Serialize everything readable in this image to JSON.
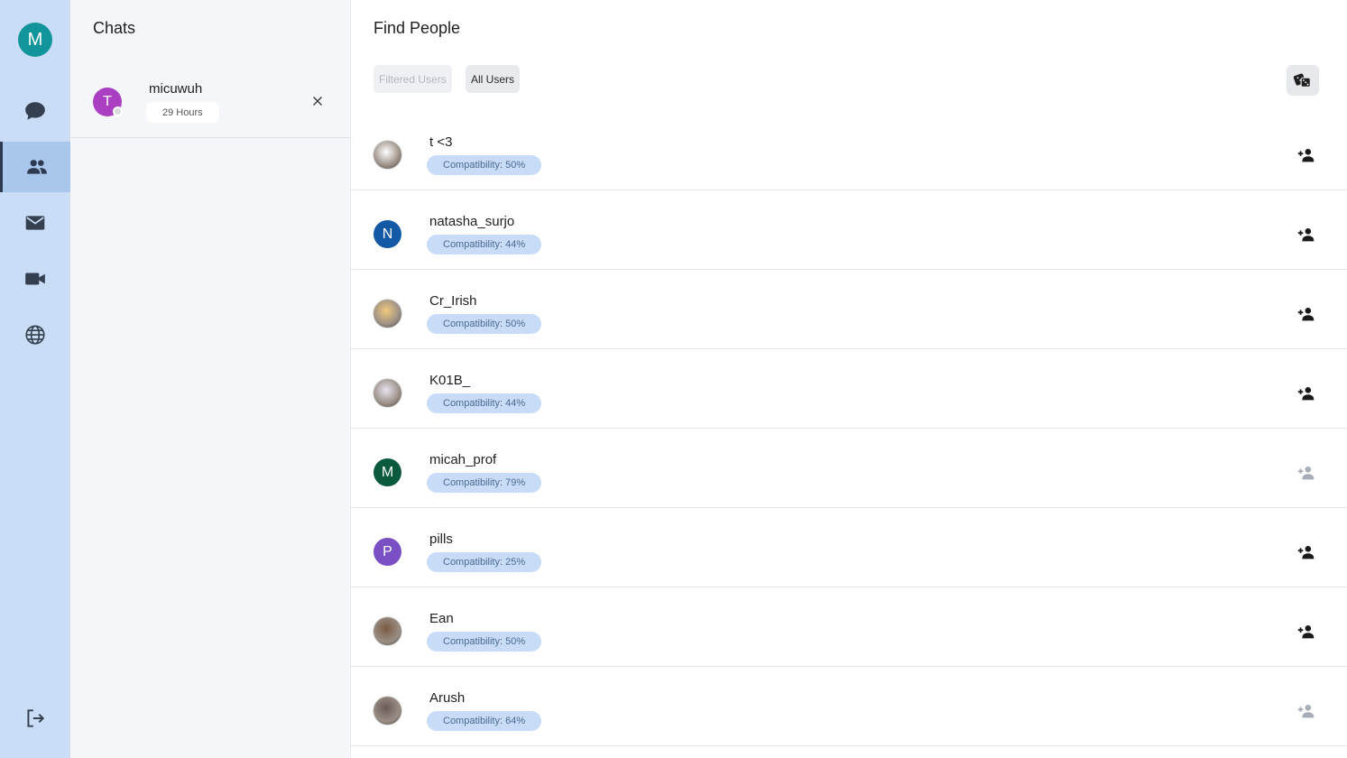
{
  "rail": {
    "user_initial": "M",
    "items": [
      {
        "icon": "chat-bubble-icon",
        "active": false
      },
      {
        "icon": "people-icon",
        "active": true
      },
      {
        "icon": "mail-icon",
        "active": false
      },
      {
        "icon": "video-camera-icon",
        "active": false
      },
      {
        "icon": "globe-icon",
        "active": false
      }
    ],
    "logout_icon": "logout-icon"
  },
  "chats": {
    "title": "Chats",
    "items": [
      {
        "initial": "T",
        "name": "micuwuh",
        "time": "29 Hours",
        "avatar_color": "#ab3fc2"
      }
    ]
  },
  "main": {
    "title": "Find People",
    "filters": {
      "filtered": "Filtered Users",
      "all": "All Users"
    },
    "random_icon": "dice-icon",
    "people": [
      {
        "name": "t <3",
        "compat": "Compatibility: 50%",
        "initial": "",
        "avatar_color": "#ffffff",
        "photo": true,
        "add_enabled": true
      },
      {
        "name": "natasha_surjo",
        "compat": "Compatibility: 44%",
        "initial": "N",
        "avatar_color": "#1459a5",
        "photo": false,
        "add_enabled": true
      },
      {
        "name": "Cr_Irish",
        "compat": "Compatibility: 50%",
        "initial": "",
        "avatar_color": "#f1c97c",
        "photo": true,
        "add_enabled": true
      },
      {
        "name": "K01B_",
        "compat": "Compatibility: 44%",
        "initial": "",
        "avatar_color": "#e7e3ef",
        "photo": true,
        "add_enabled": true
      },
      {
        "name": "micah_prof",
        "compat": "Compatibility: 79%",
        "initial": "M",
        "avatar_color": "#0b5a3e",
        "photo": false,
        "add_enabled": false
      },
      {
        "name": "pills",
        "compat": "Compatibility: 25%",
        "initial": "P",
        "avatar_color": "#7b4fc4",
        "photo": false,
        "add_enabled": true
      },
      {
        "name": "Ean",
        "compat": "Compatibility: 50%",
        "initial": "",
        "avatar_color": "#7a5a40",
        "photo": true,
        "add_enabled": true
      },
      {
        "name": "Arush",
        "compat": "Compatibility: 64%",
        "initial": "",
        "avatar_color": "#6b5a55",
        "photo": true,
        "add_enabled": false
      }
    ]
  }
}
